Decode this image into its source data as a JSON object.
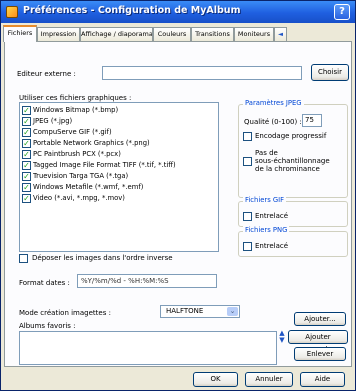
{
  "window": {
    "title": "Préférences - Configuration de MyAlbum",
    "help_label": "?"
  },
  "tabs": [
    "Fichiers",
    "Impression",
    "Affichage / diaporama",
    "Couleurs",
    "Transitions",
    "Moniteurs"
  ],
  "tabs_overflow_label": "◄",
  "fichiers": {
    "editor_label": "Editeur externe :",
    "editor_value": "",
    "choose_label": "Choisir",
    "use_files_label": "Utiliser ces fichiers graphiques :",
    "file_types": [
      {
        "label": "Windows Bitmap (*.bmp)",
        "checked": true
      },
      {
        "label": "JPEG (*.jpg)",
        "checked": true
      },
      {
        "label": "CompuServe GIF (*.gif)",
        "checked": true
      },
      {
        "label": "Portable Network Graphics (*.png)",
        "checked": true
      },
      {
        "label": "PC Paintbrush PCX (*.pcx)",
        "checked": true
      },
      {
        "label": "Tagged Image File Format TIFF (*.tif, *.tiff)",
        "checked": true
      },
      {
        "label": "Truevision Targa TGA (*.tga)",
        "checked": true
      },
      {
        "label": "Windows Metafile (*.wmf, *.emf)",
        "checked": true
      },
      {
        "label": "Video (*.avi, *.mpg, *.mov)",
        "checked": true
      }
    ],
    "reverse_order_label": "Déposer les images dans l'ordre inverse",
    "reverse_order_checked": false,
    "date_format_label": "Format dates :",
    "date_format_value": "%Y/%m/%d - %H:%M:%S",
    "thumb_mode_label": "Mode création imagettes :",
    "thumb_mode_value": "HALFTONE",
    "favorites_label": "Albums favoris :"
  },
  "jpeg": {
    "legend": "Paramètres JPEG",
    "quality_label": "Qualité (0-100) :",
    "quality_value": "75",
    "progressive_label": "Encodage progressif",
    "progressive_checked": false,
    "no_subsampling_label_1": "Pas de",
    "no_subsampling_label_2": "sous-échantillonnage",
    "no_subsampling_label_3": "de la chrominance",
    "no_subsampling_checked": false
  },
  "gif": {
    "legend": "Fichiers GIF",
    "interlaced_label": "Entrelacé",
    "interlaced_checked": false
  },
  "png": {
    "legend": "Fichiers PNG",
    "interlaced_label": "Entrelacé",
    "interlaced_checked": false
  },
  "favorites_buttons": {
    "add": "Ajouter...",
    "add_current": "Ajouter courant...",
    "remove": "Enlever"
  },
  "footer": {
    "ok": "OK",
    "cancel": "Annuler",
    "help": "Aide"
  }
}
